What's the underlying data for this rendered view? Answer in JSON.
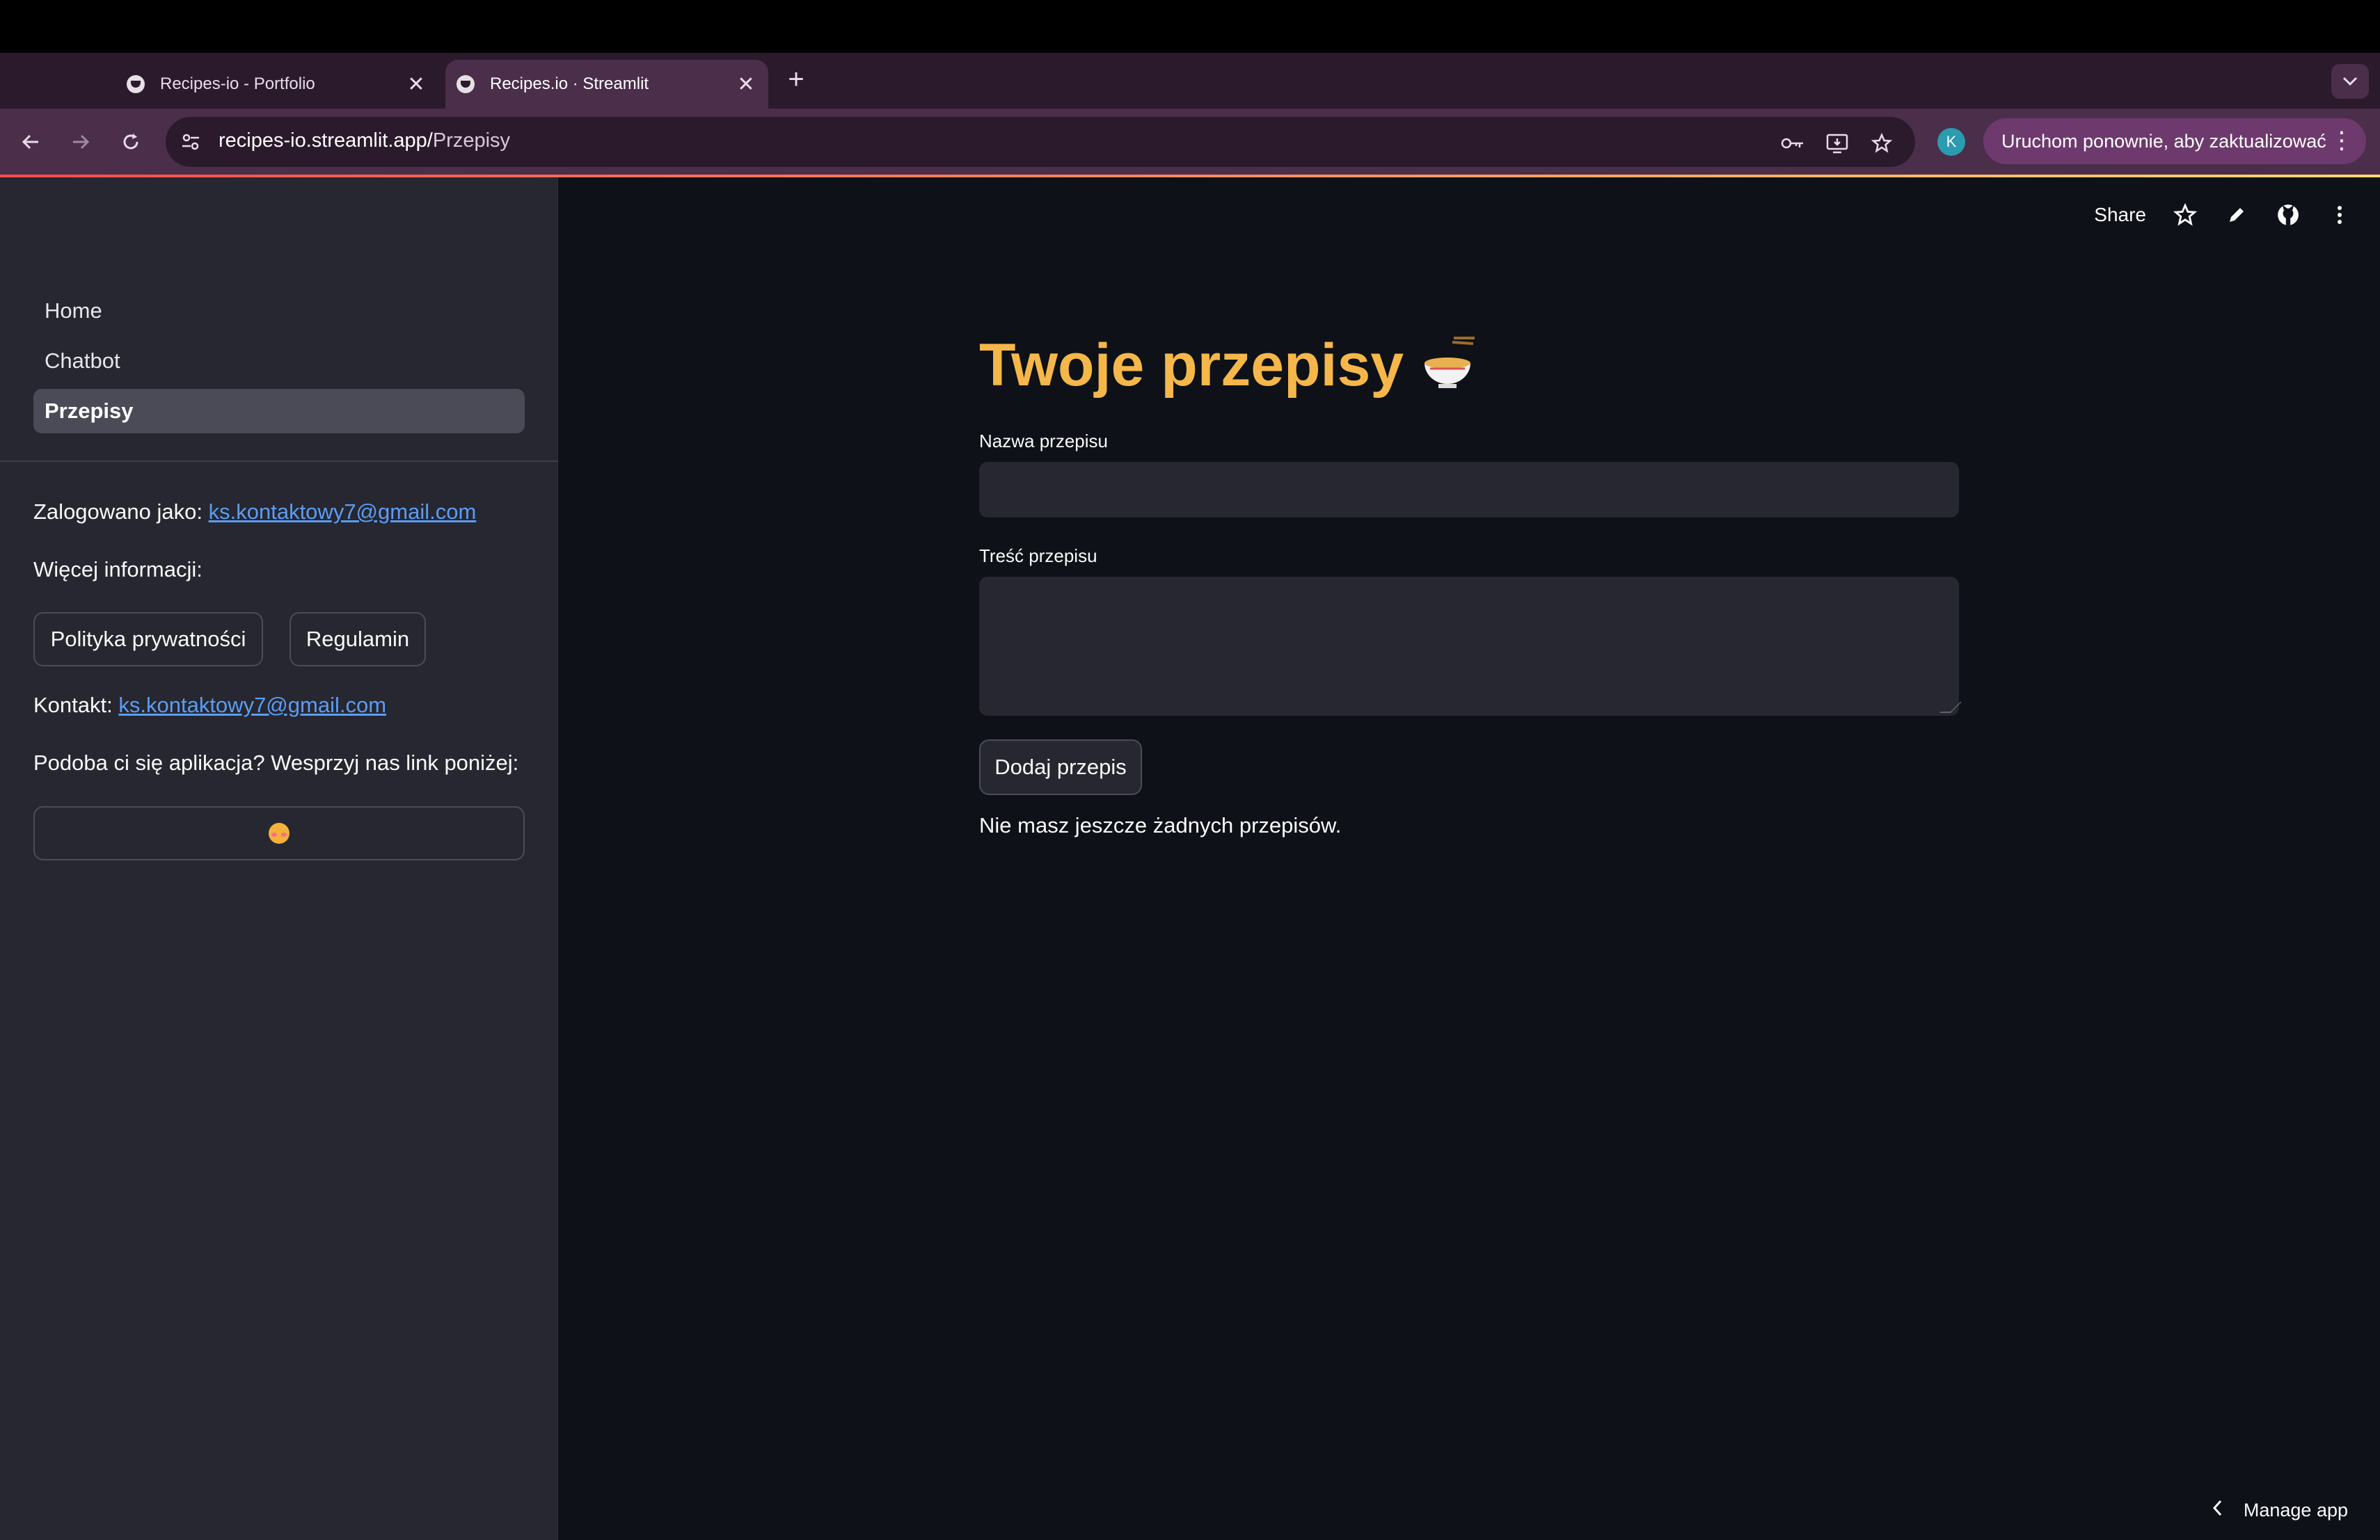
{
  "browser": {
    "tabs": [
      {
        "title": "Recipes-io - Portfolio",
        "active": false
      },
      {
        "title": "Recipes.io · Streamlit",
        "active": true
      }
    ],
    "url_host": "recipes-io.streamlit.app/",
    "url_path": "Przepisy",
    "profile_initial": "K",
    "update_label": "Uruchom ponownie, aby zaktualizować",
    "icons": [
      "back-icon",
      "forward-icon",
      "reload-icon",
      "site-settings-icon",
      "password-key-icon",
      "install-app-icon",
      "bookmark-star-icon",
      "menu-dots-icon"
    ]
  },
  "sidebar": {
    "nav": [
      {
        "label": "Home",
        "active": false
      },
      {
        "label": "Chatbot",
        "active": false
      },
      {
        "label": "Przepisy",
        "active": true
      }
    ],
    "logged_in_prefix": "Zalogowano jako:",
    "logged_in_email": "ks.kontaktowy7@gmail.com",
    "more_info": "Więcej informacji:",
    "privacy_button": "Polityka prywatności",
    "terms_button": "Regulamin",
    "contact_prefix": "Kontakt:",
    "contact_email": "ks.kontaktowy7@gmail.com",
    "support_text": "Podoba ci się aplikacja? Wesprzyj nas link poniżej:"
  },
  "header": {
    "share_label": "Share"
  },
  "main": {
    "title": "Twoje przepisy",
    "name_label": "Nazwa przepisu",
    "name_value": "",
    "content_label": "Treść przepisu",
    "content_value": "",
    "add_button": "Dodaj przepis",
    "empty_message": "Nie masz jeszcze żadnych przepisów."
  },
  "footer": {
    "manage_label": "Manage app"
  },
  "colors": {
    "accent_title": "#f5b74a",
    "link": "#5b9df5",
    "sidebar_bg": "#262730",
    "main_bg": "#0e1117"
  }
}
